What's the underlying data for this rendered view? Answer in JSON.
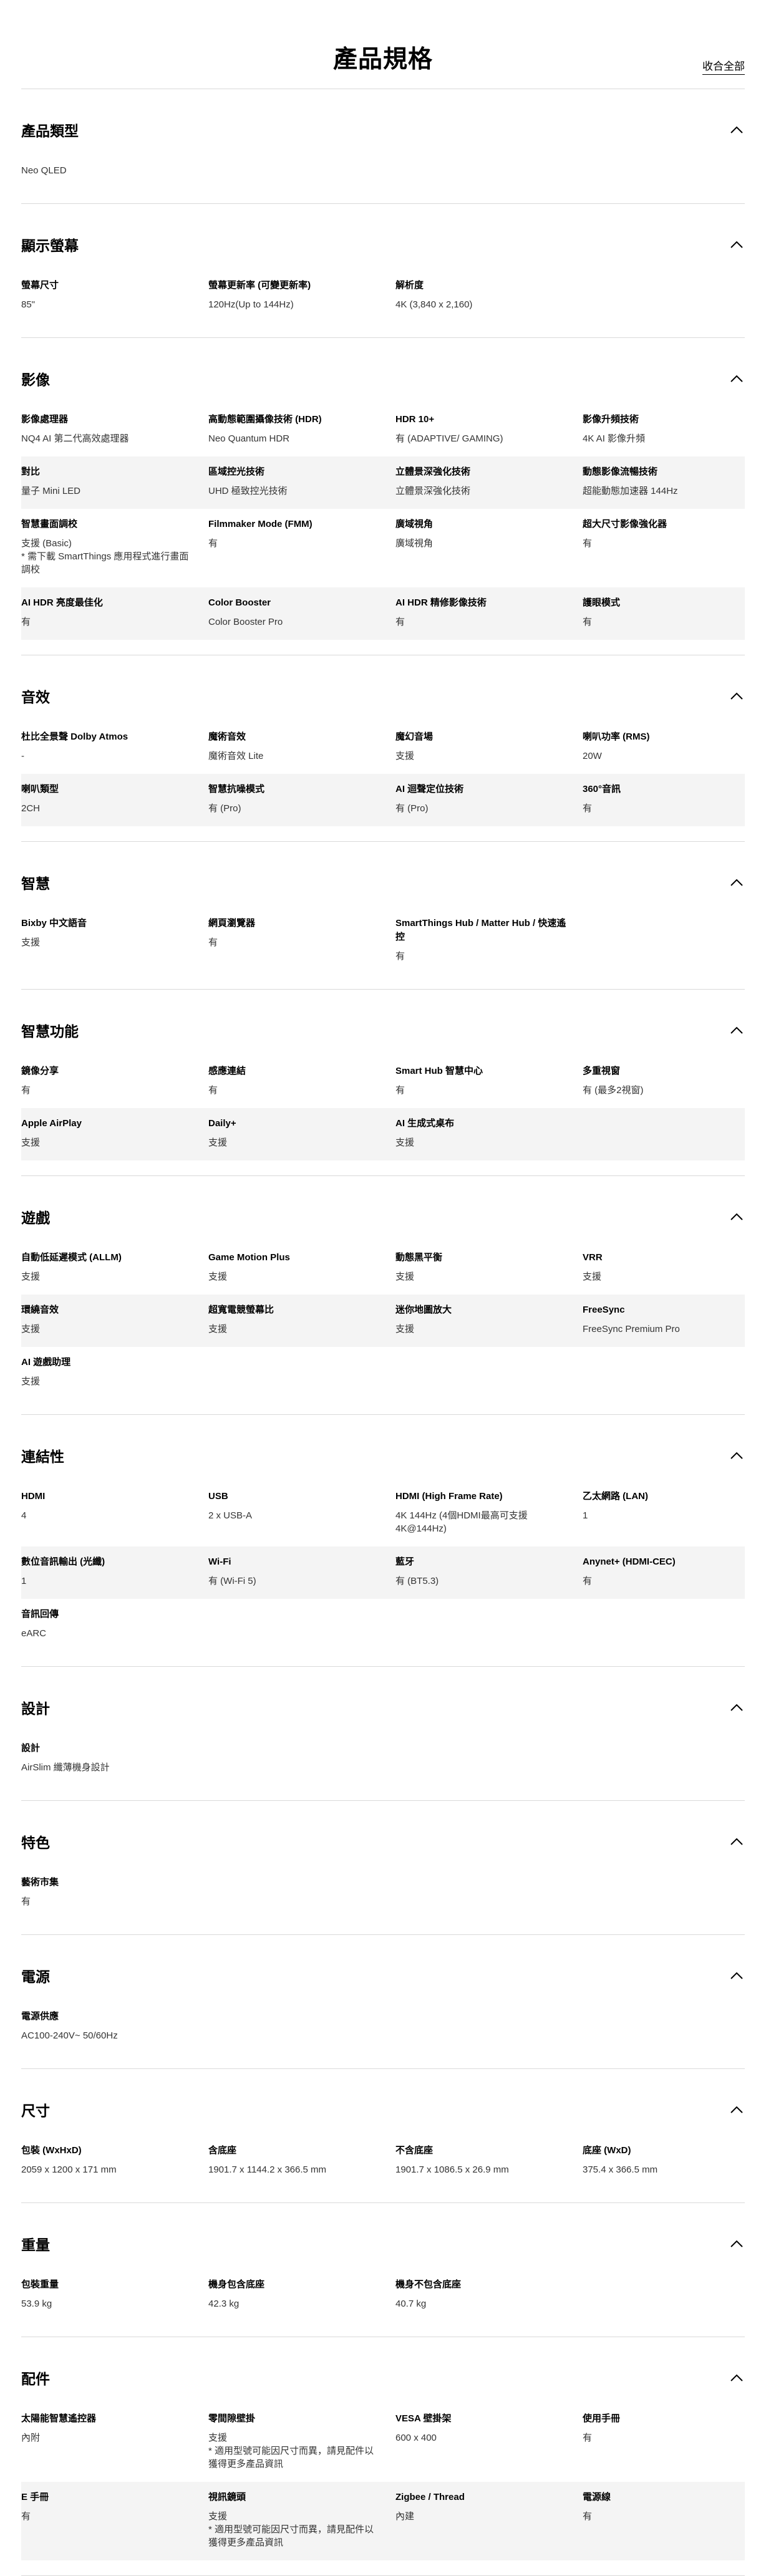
{
  "page": {
    "title": "產品規格",
    "collapse_all": "收合全部"
  },
  "sections": [
    {
      "title": "產品類型",
      "rows": [
        [
          {
            "label": "",
            "value": "Neo QLED"
          }
        ]
      ]
    },
    {
      "title": "顯示螢幕",
      "rows": [
        [
          {
            "label": "螢幕尺寸",
            "value": "85\""
          },
          {
            "label": "螢幕更新率 (可變更新率)",
            "value": "120Hz(Up to 144Hz)"
          },
          {
            "label": "解析度",
            "value": "4K (3,840 x 2,160)"
          }
        ]
      ]
    },
    {
      "title": "影像",
      "rows": [
        [
          {
            "label": "影像處理器",
            "value": "NQ4 AI 第二代高效處理器"
          },
          {
            "label": "高動態範圍攝像技術 (HDR)",
            "value": "Neo Quantum HDR"
          },
          {
            "label": "HDR 10+",
            "value": "有 (ADAPTIVE/ GAMING)"
          },
          {
            "label": "影像升頻技術",
            "value": "4K AI 影像升頻"
          }
        ],
        [
          {
            "label": "對比",
            "value": "量子 Mini LED"
          },
          {
            "label": "區域控光技術",
            "value": "UHD 極致控光技術"
          },
          {
            "label": "立體景深強化技術",
            "value": "立體景深強化技術"
          },
          {
            "label": "動態影像流暢技術",
            "value": "超能動態加速器 144Hz"
          }
        ],
        [
          {
            "label": "智慧畫面調校",
            "value": "支援 (Basic)\n* 需下載 SmartThings 應用程式進行畫面調校"
          },
          {
            "label": "Filmmaker Mode (FMM)",
            "value": "有"
          },
          {
            "label": "廣域視角",
            "value": "廣域視角"
          },
          {
            "label": "超大尺寸影像強化器",
            "value": "有"
          }
        ],
        [
          {
            "label": "AI HDR 亮度最佳化",
            "value": "有"
          },
          {
            "label": "Color Booster",
            "value": "Color Booster Pro"
          },
          {
            "label": "AI HDR 精修影像技術",
            "value": "有"
          },
          {
            "label": "護眼模式",
            "value": "有"
          }
        ]
      ]
    },
    {
      "title": "音效",
      "rows": [
        [
          {
            "label": "杜比全景聲 Dolby Atmos",
            "value": "-"
          },
          {
            "label": "魔術音效",
            "value": "魔術音效 Lite"
          },
          {
            "label": "魔幻音場",
            "value": "支援"
          },
          {
            "label": "喇叭功率 (RMS)",
            "value": "20W"
          }
        ],
        [
          {
            "label": "喇叭類型",
            "value": "2CH"
          },
          {
            "label": "智慧抗噪模式",
            "value": "有 (Pro)"
          },
          {
            "label": "AI 迴聲定位技術",
            "value": "有 (Pro)"
          },
          {
            "label": "360°音訊",
            "value": "有"
          }
        ]
      ]
    },
    {
      "title": "智慧",
      "rows": [
        [
          {
            "label": "Bixby 中文語音",
            "value": "支援"
          },
          {
            "label": "網頁瀏覽器",
            "value": "有"
          },
          {
            "label": "SmartThings Hub / Matter Hub / 快速遙控",
            "value": "有"
          }
        ]
      ]
    },
    {
      "title": "智慧功能",
      "rows": [
        [
          {
            "label": "鏡像分享",
            "value": "有"
          },
          {
            "label": "感應連結",
            "value": "有"
          },
          {
            "label": "Smart Hub 智慧中心",
            "value": "有"
          },
          {
            "label": "多重視窗",
            "value": "有 (最多2視窗)"
          }
        ],
        [
          {
            "label": "Apple AirPlay",
            "value": "支援"
          },
          {
            "label": "Daily+",
            "value": "支援"
          },
          {
            "label": "AI 生成式桌布",
            "value": "支援"
          }
        ]
      ]
    },
    {
      "title": "遊戲",
      "rows": [
        [
          {
            "label": "自動低延遲模式 (ALLM)",
            "value": "支援"
          },
          {
            "label": "Game Motion Plus",
            "value": "支援"
          },
          {
            "label": "動態黑平衡",
            "value": "支援"
          },
          {
            "label": "VRR",
            "value": "支援"
          }
        ],
        [
          {
            "label": "環繞音效",
            "value": "支援"
          },
          {
            "label": "超寬電競螢幕比",
            "value": "支援"
          },
          {
            "label": "迷你地圖放大",
            "value": "支援"
          },
          {
            "label": "FreeSync",
            "value": "FreeSync Premium Pro"
          }
        ],
        [
          {
            "label": "AI 遊戲助理",
            "value": "支援"
          }
        ]
      ]
    },
    {
      "title": "連結性",
      "rows": [
        [
          {
            "label": "HDMI",
            "value": "4"
          },
          {
            "label": "USB",
            "value": "2 x USB-A"
          },
          {
            "label": "HDMI (High Frame Rate)",
            "value": "4K 144Hz (4個HDMI最高可支援4K@144Hz)"
          },
          {
            "label": "乙太網路 (LAN)",
            "value": "1"
          }
        ],
        [
          {
            "label": "數位音訊輸出 (光纖)",
            "value": "1"
          },
          {
            "label": "Wi-Fi",
            "value": "有 (Wi-Fi 5)"
          },
          {
            "label": "藍牙",
            "value": "有 (BT5.3)"
          },
          {
            "label": "Anynet+ (HDMI-CEC)",
            "value": "有"
          }
        ],
        [
          {
            "label": "音訊回傳",
            "value": "eARC"
          }
        ]
      ]
    },
    {
      "title": "設計",
      "rows": [
        [
          {
            "label": "設計",
            "value": "AirSlim 纖薄機身設計"
          }
        ]
      ]
    },
    {
      "title": "特色",
      "rows": [
        [
          {
            "label": "藝術市集",
            "value": "有"
          }
        ]
      ]
    },
    {
      "title": "電源",
      "rows": [
        [
          {
            "label": "電源供應",
            "value": "AC100-240V~ 50/60Hz"
          }
        ]
      ]
    },
    {
      "title": "尺寸",
      "rows": [
        [
          {
            "label": "包裝 (WxHxD)",
            "value": "2059 x 1200 x 171 mm"
          },
          {
            "label": "含底座",
            "value": "1901.7 x 1144.2 x 366.5 mm"
          },
          {
            "label": "不含底座",
            "value": "1901.7 x 1086.5 x 26.9 mm"
          },
          {
            "label": "底座 (WxD)",
            "value": "375.4 x 366.5 mm"
          }
        ]
      ]
    },
    {
      "title": "重量",
      "rows": [
        [
          {
            "label": "包裝重量",
            "value": "53.9 kg"
          },
          {
            "label": "機身包含底座",
            "value": "42.3 kg"
          },
          {
            "label": "機身不包含底座",
            "value": "40.7 kg"
          }
        ]
      ]
    },
    {
      "title": "配件",
      "rows": [
        [
          {
            "label": "太陽能智慧遙控器",
            "value": "內附"
          },
          {
            "label": "零間隙壁掛",
            "value": "支援\n* 適用型號可能因尺寸而異，請見配件以獲得更多產品資訊"
          },
          {
            "label": "VESA 壁掛架",
            "value": "600 x 400"
          },
          {
            "label": "使用手冊",
            "value": "有"
          }
        ],
        [
          {
            "label": "E 手冊",
            "value": "有"
          },
          {
            "label": "視訊鏡頭",
            "value": "支援\n* 適用型號可能因尺寸而異，請見配件以獲得更多產品資訊"
          },
          {
            "label": "Zigbee / Thread",
            "value": "內建"
          },
          {
            "label": "電源線",
            "value": "有"
          }
        ]
      ]
    }
  ]
}
